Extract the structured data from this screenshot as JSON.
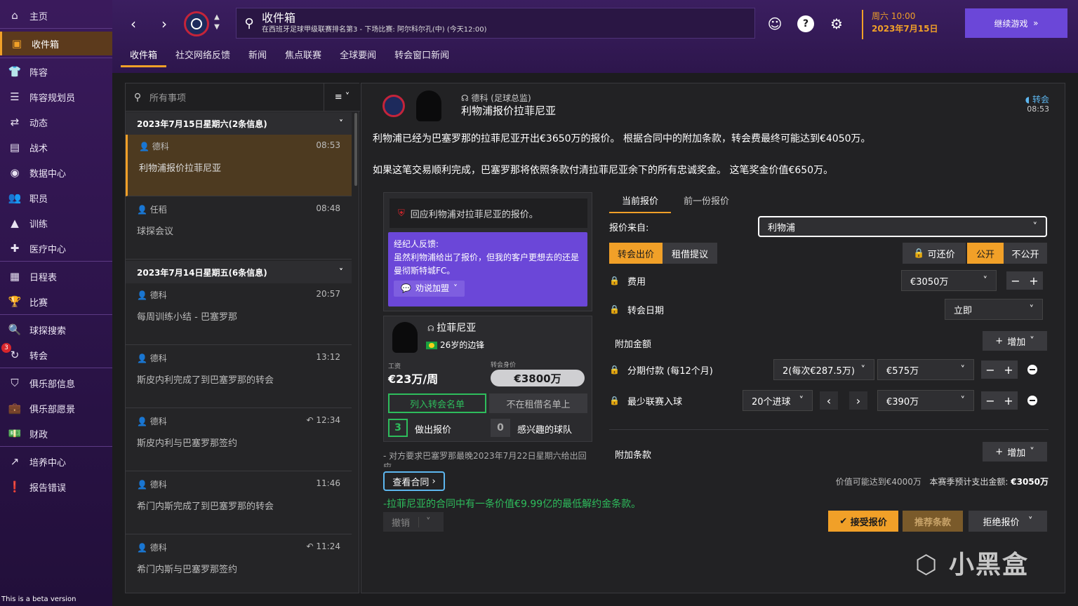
{
  "sidebar": {
    "items": [
      {
        "label": "主页",
        "icon": "home-icon"
      },
      {
        "label": "收件箱",
        "icon": "inbox-icon"
      },
      {
        "label": "阵容",
        "icon": "squad-icon"
      },
      {
        "label": "阵容规划员",
        "icon": "squad-planner-icon"
      },
      {
        "label": "动态",
        "icon": "dynamics-icon"
      },
      {
        "label": "战术",
        "icon": "tactics-icon"
      },
      {
        "label": "数据中心",
        "icon": "data-hub-icon"
      },
      {
        "label": "职员",
        "icon": "staff-icon"
      },
      {
        "label": "训练",
        "icon": "training-icon"
      },
      {
        "label": "医疗中心",
        "icon": "medical-icon"
      },
      {
        "label": "日程表",
        "icon": "calendar-icon"
      },
      {
        "label": "比赛",
        "icon": "trophy-icon"
      },
      {
        "label": "球探搜索",
        "icon": "scouting-icon"
      },
      {
        "label": "转会",
        "icon": "transfers-icon",
        "badge": "3"
      },
      {
        "label": "俱乐部信息",
        "icon": "club-info-icon"
      },
      {
        "label": "俱乐部愿景",
        "icon": "club-vision-icon"
      },
      {
        "label": "财政",
        "icon": "finances-icon"
      },
      {
        "label": "培养中心",
        "icon": "development-icon"
      },
      {
        "label": "报告错误",
        "icon": "report-bug-icon"
      }
    ],
    "beta": "This is a beta version"
  },
  "topbar": {
    "title": "收件箱",
    "subtitle": "在西班牙足球甲级联赛排名第3 - 下场比赛: 阿尔科尔孔(中) (今天12:00)",
    "date_line1": "周六 10:00",
    "date_line2": "2023年7月15日",
    "continue": "继续游戏",
    "help": "?",
    "tabs": [
      "收件箱",
      "社交网络反馈",
      "新闻",
      "焦点联赛",
      "全球要闻",
      "转会窗口新闻"
    ]
  },
  "inbox": {
    "search_placeholder": "所有事项",
    "groups": [
      {
        "header": "2023年7月15日星期六(2条信息)"
      },
      {
        "header": "2023年7月14日星期五(6条信息)"
      }
    ],
    "messages": [
      {
        "from": "德科",
        "time": "08:53",
        "subject": "利物浦报价拉菲尼亚"
      },
      {
        "from": "任稻",
        "time": "08:48",
        "subject": "球探会议"
      },
      {
        "from": "德科",
        "time": "20:57",
        "subject": "每周训练小结 - 巴塞罗那"
      },
      {
        "from": "德科",
        "time": "13:12",
        "subject": "斯皮内利完成了到巴塞罗那的转会"
      },
      {
        "from": "德科",
        "time": "12:34",
        "subject": "斯皮内利与巴塞罗那签约"
      },
      {
        "from": "德科",
        "time": "11:46",
        "subject": "希门内斯完成了到巴塞罗那的转会"
      },
      {
        "from": "德科",
        "time": "11:24",
        "subject": "希门内斯与巴塞罗那签约"
      }
    ]
  },
  "detail": {
    "from": "德科 (足球总监)",
    "title": "利物浦报价拉菲尼亚",
    "type": "转会",
    "time": "08:53",
    "para1": "利物浦已经为巴塞罗那的拉菲尼亚开出€3650万的报价。 根据合同中的附加条款，转会费最终可能达到€4050万。",
    "para2": "如果这笔交易顺利完成，巴塞罗那将依照条款付清拉菲尼亚余下的所有忠诚奖金。 这笔奖金价值€650万。",
    "respond": "回应利物浦对拉菲尼亚的报价。",
    "agent_title": "经纪人反馈:",
    "agent_text": "虽然利物浦给出了报价，但我的客户更想去的还是曼彻斯特城FC。",
    "persuade": "劝说加盟",
    "player_name": "拉菲尼亚",
    "player_desc": "26岁的边锋",
    "wage_label": "工资",
    "wage": "€23万/周",
    "value_label": "转会身价",
    "value": "€3800万",
    "transfer_list": "列入转会名单",
    "loan_list": "不在租借名单上",
    "offers_count": "3",
    "offers_label": "做出报价",
    "interested_count": "0",
    "interested_label": "感兴趣的球队",
    "note": "- 对方要求巴塞罗那最晚2023年7月22日星期六给出回应",
    "view_contract": "查看合同",
    "release_clause": "-拉菲尼亚的合同中有一条价值€9.99亿的最低解约金条款。",
    "withdraw": "撤销"
  },
  "offer": {
    "tab_current": "当前报价",
    "tab_previous": "前一份报价",
    "from_label": "报价来自:",
    "from_value": "利物浦",
    "type_transfer": "转会出价",
    "type_loan": "租借提议",
    "negotiable": "可还价",
    "public": "公开",
    "private": "不公开",
    "fee_label": "费用",
    "fee_value": "€3050万",
    "date_label": "转会日期",
    "date_value": "立即",
    "addon_label": "附加金额",
    "add_label": "增加",
    "installments_label": "分期付款 (每12个月)",
    "installments_count": "2(每次€287.5万)",
    "installments_value": "€575万",
    "goals_label": "最少联赛入球",
    "goals_count": "20个进球",
    "goals_value": "€390万",
    "clauses_label": "附加条款",
    "summary_potential": "价值可能达到€4000万",
    "summary_spend_label": "本赛季预计支出金额:",
    "summary_spend_value": "€3050万",
    "accept": "接受报价",
    "suggest": "推荐条款",
    "reject": "拒绝报价"
  },
  "colors": {
    "accent": "#f1a028",
    "purple": "#6b47d8",
    "green": "#2ebd5c",
    "blue": "#5db7f0"
  }
}
